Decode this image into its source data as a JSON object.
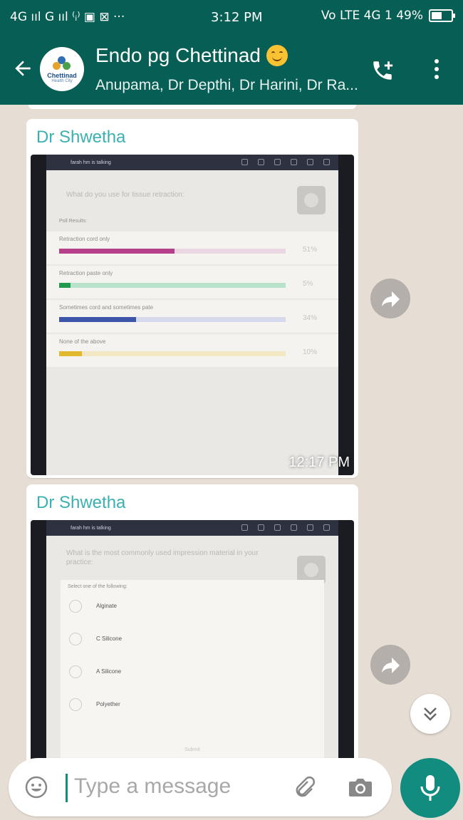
{
  "status_bar": {
    "left_indicators": "4G ııl G ııl  ⁽ᵢ⁾ ▣ ⊠ ···",
    "time": "3:12 PM",
    "right_indicators": "Vo LTE 4G 1 49%"
  },
  "header": {
    "group_name": "Endo pg Chettinad",
    "participants": "Anupama, Dr Depthi, Dr Harini, Dr Ra...",
    "avatar_text": "Chettinad",
    "avatar_subtext": "Health City"
  },
  "messages": [
    {
      "sender": "Dr Shwetha",
      "time": "12:17 PM",
      "photo": {
        "top_bar_text": "farah hm is talking",
        "question": "What do you use for tissue retraction:",
        "section_label": "Poll Results:",
        "results": [
          {
            "label": "Retraction cord only",
            "percent": 51,
            "percent_text": "51%",
            "color": "#b6418a",
            "track": "#ead7e3"
          },
          {
            "label": "Retraction paste only",
            "percent": 5,
            "percent_text": "5%",
            "color": "#1f9a4f",
            "track": "#b9e2cb"
          },
          {
            "label": "Sometimes cord and sometimes pate",
            "percent": 34,
            "percent_text": "34%",
            "color": "#3c55a8",
            "track": "#d6d9ec"
          },
          {
            "label": "None of the above",
            "percent": 10,
            "percent_text": "10%",
            "color": "#e2b92e",
            "track": "#f1e7c3"
          }
        ]
      }
    },
    {
      "sender": "Dr Shwetha",
      "photo": {
        "top_bar_text": "farah hm is talking",
        "question": "What is the most commonly used impression material in your practice:",
        "hint": "Select one of the following:",
        "options": [
          "Alginate",
          "C Silicone",
          "A Silicone",
          "Polyether"
        ],
        "submit_label": "Submit"
      }
    }
  ],
  "input": {
    "placeholder": "Type a message"
  },
  "colors": {
    "brand": "#075e54",
    "accent": "#128c7e",
    "sender_name": "#3bb0b0"
  },
  "icons": [
    "back-arrow-icon",
    "add-call-icon",
    "overflow-menu-icon",
    "forward-icon",
    "double-chevron-down-icon",
    "emoji-icon",
    "attach-icon",
    "camera-icon",
    "mic-icon"
  ]
}
